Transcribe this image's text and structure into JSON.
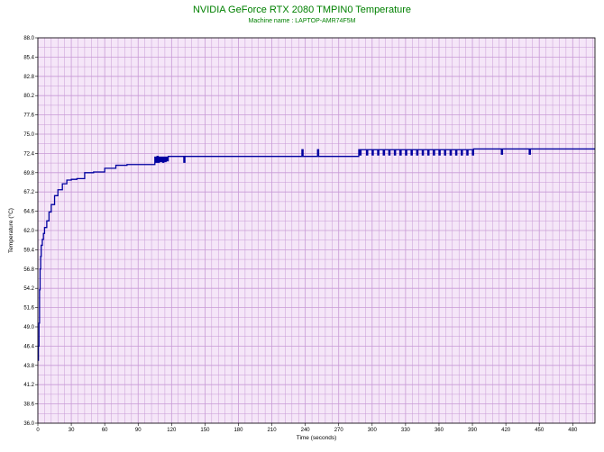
{
  "chart_data": {
    "type": "line",
    "title": "NVIDIA GeForce RTX 2080 TMPIN0 Temperature",
    "subtitle": "Machine name : LAPTOP-AMR74F5M",
    "xlabel": "Time (seconds)",
    "ylabel": "Temperature (°C)",
    "xlim": [
      0,
      500
    ],
    "ylim": [
      36.0,
      88.0
    ],
    "xticks": [
      "0",
      "30",
      "60",
      "90",
      "120",
      "150",
      "180",
      "210",
      "240",
      "270",
      "300",
      "330",
      "360",
      "390",
      "420",
      "450",
      "480"
    ],
    "yticks": [
      "36.0",
      "38.6",
      "41.2",
      "43.8",
      "46.4",
      "49.0",
      "51.6",
      "54.2",
      "56.8",
      "59.4",
      "62.0",
      "64.6",
      "67.2",
      "69.8",
      "72.4",
      "75.0",
      "77.6",
      "80.2",
      "82.8",
      "85.4",
      "88.0"
    ],
    "grid": true,
    "colors": {
      "plot_background": "#f5e6f8",
      "grid": "#c89ad6",
      "line": "#0000a0",
      "title": "#008000"
    },
    "series": [
      {
        "x": [
          0,
          0.5,
          1,
          1.5,
          2,
          2.5,
          3,
          4,
          5,
          6,
          8,
          10,
          12,
          15,
          18,
          22,
          26,
          30,
          35,
          42,
          50,
          60,
          70,
          80,
          104,
          105,
          106,
          107,
          108,
          109,
          110,
          111,
          112,
          113,
          114,
          115,
          116,
          117,
          130,
          131,
          132,
          133,
          150,
          200,
          236,
          237,
          238,
          250,
          251,
          252,
          287,
          288,
          289,
          290,
          295,
          296,
          300,
          301,
          305,
          306,
          310,
          311,
          315,
          316,
          320,
          321,
          325,
          326,
          330,
          331,
          335,
          336,
          340,
          341,
          345,
          346,
          350,
          351,
          355,
          356,
          360,
          361,
          365,
          366,
          370,
          371,
          375,
          376,
          380,
          381,
          385,
          386,
          390,
          391,
          415,
          416,
          417,
          440,
          441,
          442,
          500
        ],
        "y": [
          44.5,
          46.4,
          49.5,
          54.0,
          56.8,
          58.5,
          60.0,
          60.8,
          61.6,
          62.4,
          63.3,
          64.5,
          65.5,
          66.7,
          67.5,
          68.3,
          68.8,
          68.9,
          69.0,
          69.8,
          69.9,
          70.4,
          70.8,
          70.9,
          70.9,
          71.9,
          71.2,
          72.0,
          71.2,
          71.9,
          71.3,
          71.9,
          71.2,
          71.9,
          71.3,
          71.9,
          71.4,
          72.0,
          72.0,
          71.2,
          72.0,
          72.0,
          72.0,
          72.0,
          72.0,
          72.9,
          72.0,
          72.0,
          72.9,
          72.0,
          72.0,
          72.9,
          72.2,
          72.9,
          72.2,
          72.9,
          72.2,
          72.9,
          72.2,
          72.9,
          72.2,
          72.9,
          72.2,
          72.9,
          72.2,
          72.9,
          72.2,
          72.9,
          72.2,
          72.9,
          72.2,
          72.9,
          72.2,
          72.9,
          72.2,
          72.9,
          72.2,
          72.9,
          72.2,
          72.9,
          72.2,
          72.9,
          72.2,
          72.9,
          72.2,
          72.9,
          72.2,
          72.9,
          72.2,
          72.9,
          72.2,
          72.9,
          72.2,
          73.0,
          73.0,
          72.3,
          73.0,
          73.0,
          72.3,
          73.0,
          73.0
        ]
      }
    ]
  }
}
